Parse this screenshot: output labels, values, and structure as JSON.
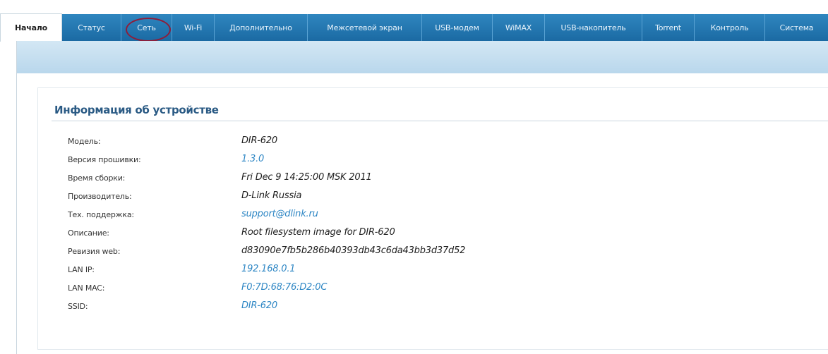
{
  "tabs": [
    {
      "label": "Начало"
    },
    {
      "label": "Статус"
    },
    {
      "label": "Сеть"
    },
    {
      "label": "Wi-Fi"
    },
    {
      "label": "Дополнительно"
    },
    {
      "label": "Межсетевой экран"
    },
    {
      "label": "USB-модем"
    },
    {
      "label": "WiMAX"
    },
    {
      "label": "USB-накопитель"
    },
    {
      "label": "Torrent"
    },
    {
      "label": "Контроль"
    },
    {
      "label": "Система"
    }
  ],
  "highlighted_tab": "Сеть",
  "section": {
    "title": "Информация об устройстве"
  },
  "device_info": [
    {
      "label": "Модель:",
      "value": "DIR-620",
      "link": false
    },
    {
      "label": "Версия прошивки:",
      "value": "1.3.0",
      "link": true
    },
    {
      "label": "Время сборки:",
      "value": "Fri Dec 9 14:25:00 MSK 2011",
      "link": false
    },
    {
      "label": "Производитель:",
      "value": "D-Link Russia",
      "link": false
    },
    {
      "label": "Тех. поддержка:",
      "value": "support@dlink.ru",
      "link": true
    },
    {
      "label": "Описание:",
      "value": "Root filesystem image for DIR-620",
      "link": false
    },
    {
      "label": "Ревизия web:",
      "value": "d83090e7fb5b286b40393db43c6da43bb3d37d52",
      "link": false
    },
    {
      "label": "LAN IP:",
      "value": "192.168.0.1",
      "link": true
    },
    {
      "label": "LAN MAC:",
      "value": "F0:7D:68:76:D2:0C",
      "link": true
    },
    {
      "label": "SSID:",
      "value": "DIR-620",
      "link": true
    }
  ],
  "colors": {
    "nav_blue": "#1b6aa3",
    "band_blue": "#c6e0f0",
    "title_blue": "#2a5a84",
    "link_blue": "#2d86c4",
    "annotation_circle": "#8e1d3a"
  }
}
